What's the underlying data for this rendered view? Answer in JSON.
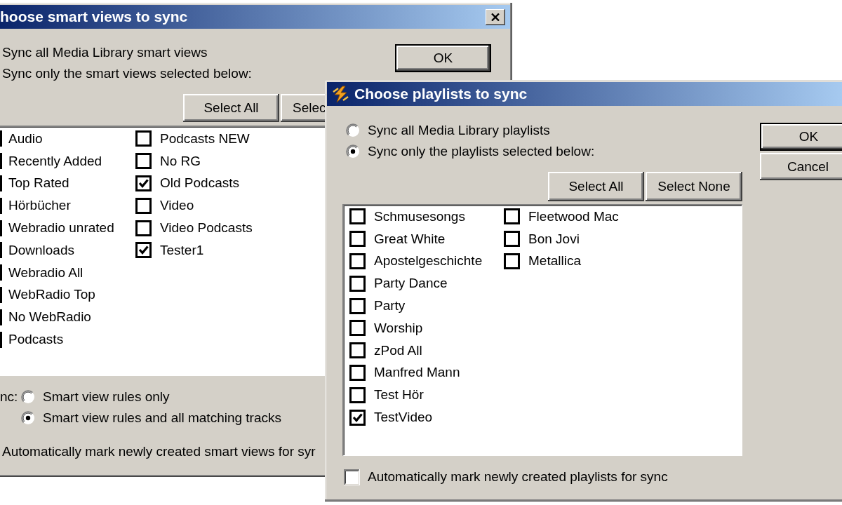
{
  "smart_views_window": {
    "title": "hoose smart views to sync",
    "sync_options": [
      "Sync all Media Library smart views",
      "Sync only the smart views selected below:"
    ],
    "buttons": [
      {
        "label": "OK",
        "default": true
      }
    ],
    "list_buttons": [
      "Select All",
      "Selec"
    ],
    "smart_views": {
      "column_1": [
        "Audio",
        "Recently Added",
        "Top Rated",
        "Hörbücher",
        "Webradio unrated",
        "Downloads",
        "Webradio All",
        "WebRadio Top",
        "No WebRadio",
        "Podcasts"
      ],
      "column_2": [
        {
          "label": "Podcasts NEW",
          "checked": false
        },
        {
          "label": "No RG",
          "checked": false
        },
        {
          "label": "Old Podcasts",
          "checked": true
        },
        {
          "label": "Video",
          "checked": false
        },
        {
          "label": "Video Podcasts",
          "checked": false
        },
        {
          "label": "Tester1",
          "checked": true
        }
      ]
    },
    "sync_mode": {
      "label": "nc:",
      "options": [
        {
          "label": "Smart view rules only",
          "selected": false
        },
        {
          "label": "Smart view rules and all matching tracks",
          "selected": true
        }
      ]
    },
    "auto_mark": "Automatically mark newly created smart views for syr"
  },
  "playlists_window": {
    "title": "Choose playlists to sync",
    "sync_options": [
      {
        "label": "Sync all Media Library playlists",
        "selected": false
      },
      {
        "label": "Sync only the playlists selected below:",
        "selected": true
      }
    ],
    "buttons": [
      {
        "label": "OK",
        "default": true
      },
      {
        "label": "Cancel",
        "default": false
      }
    ],
    "list_buttons": [
      "Select All",
      "Select None"
    ],
    "playlists": {
      "column_1": [
        {
          "label": "Schmusesongs",
          "checked": false
        },
        {
          "label": "Great White",
          "checked": false
        },
        {
          "label": "Apostelgeschichte",
          "checked": false
        },
        {
          "label": "Party Dance",
          "checked": false
        },
        {
          "label": "Party",
          "checked": false
        },
        {
          "label": "Worship",
          "checked": false
        },
        {
          "label": "zPod All",
          "checked": false
        },
        {
          "label": "Manfred Mann",
          "checked": false
        },
        {
          "label": "Test Hör",
          "checked": false
        },
        {
          "label": "TestVideo",
          "checked": true
        }
      ],
      "column_2": [
        {
          "label": "Fleetwood Mac",
          "checked": false
        },
        {
          "label": "Bon Jovi",
          "checked": false
        },
        {
          "label": "Metallica",
          "checked": false
        }
      ]
    },
    "auto_mark": {
      "label": "Automatically mark newly created playlists for sync",
      "checked": false
    }
  }
}
